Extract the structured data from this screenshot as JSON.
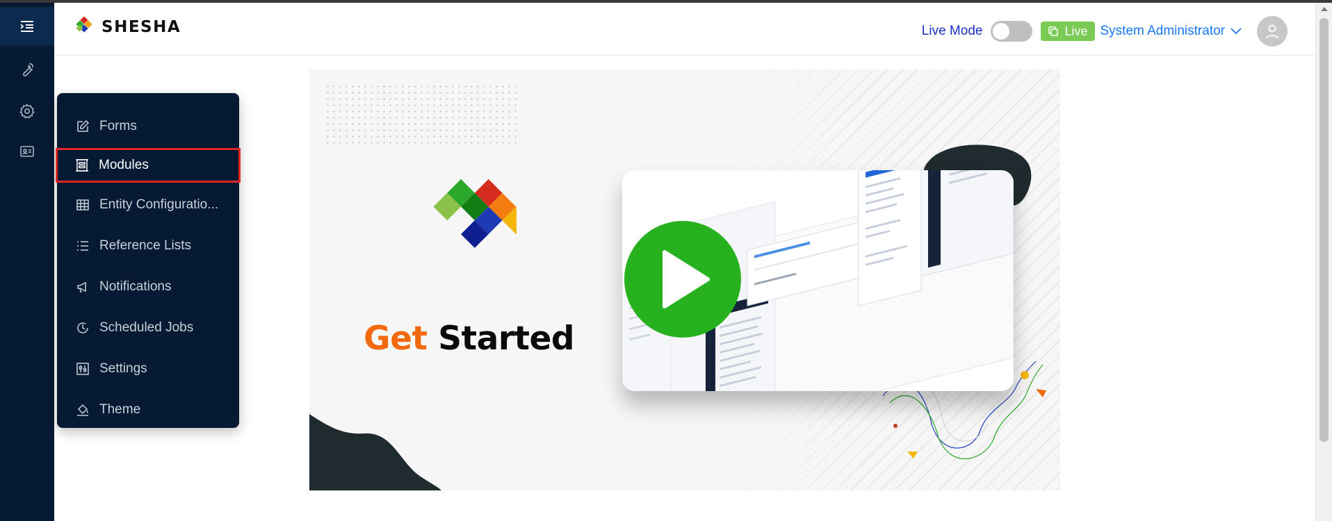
{
  "header": {
    "brand": "SHESHA",
    "live_mode_label": "Live Mode",
    "live_badge": "Live",
    "user_name": "System Administrator"
  },
  "rail": {
    "items": [
      "menu-fold-icon",
      "tool-icon",
      "settings-icon",
      "id-card-icon"
    ]
  },
  "menu": {
    "items": [
      {
        "label": "Forms",
        "icon": "edit-icon"
      },
      {
        "label": "Modules",
        "icon": "modules-icon",
        "selected": true
      },
      {
        "label": "Entity Configuratio...",
        "icon": "table-icon"
      },
      {
        "label": "Reference Lists",
        "icon": "list-icon"
      },
      {
        "label": "Notifications",
        "icon": "megaphone-icon"
      },
      {
        "label": "Scheduled Jobs",
        "icon": "clock-icon"
      },
      {
        "label": "Settings",
        "icon": "sliders-icon"
      },
      {
        "label": "Theme",
        "icon": "paint-bucket-icon"
      }
    ]
  },
  "banner": {
    "title_a": "Get",
    "title_b": "Started"
  },
  "colors": {
    "rail_bg": "#071a33",
    "live_badge": "#7acb55",
    "link_blue": "#1877f2",
    "play_green": "#27b11f",
    "accent_orange": "#f26a0f",
    "selection_outline": "#e22626"
  }
}
